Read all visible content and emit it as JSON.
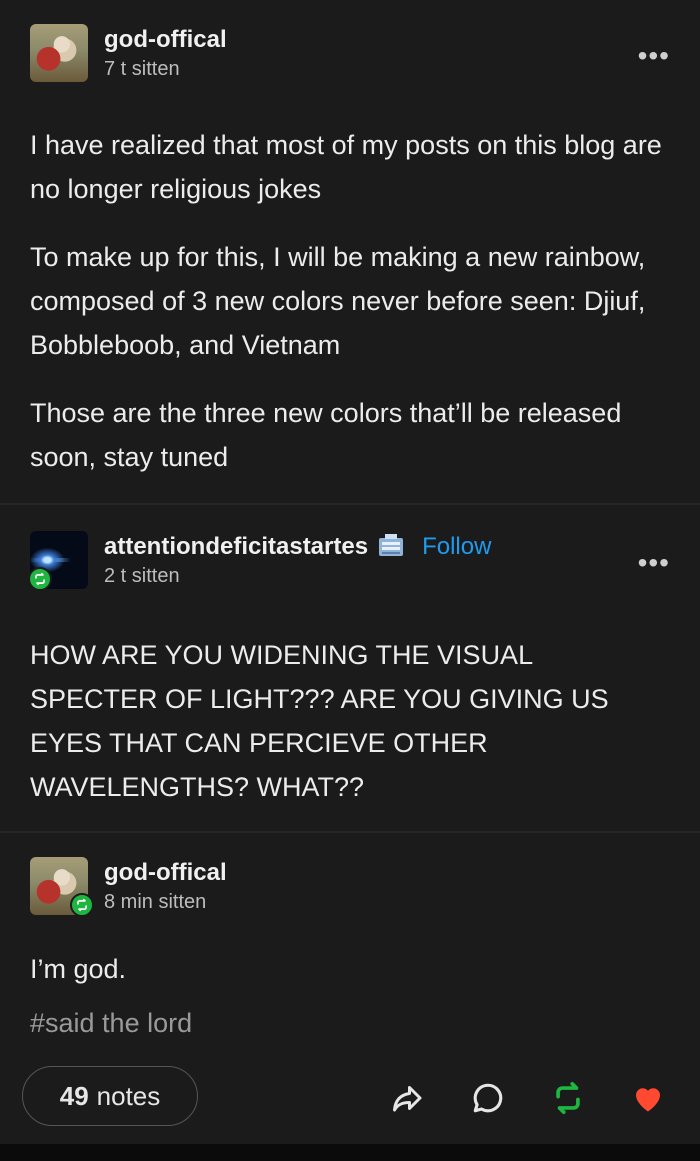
{
  "posts": [
    {
      "username": "god-offical",
      "time": "7 t sitten",
      "avatar": "god-painting-avatar",
      "paragraphs": [
        "I have realized that most of my posts on this blog are no longer religious jokes",
        "To make up for this, I will be making a new rainbow, composed of 3 new colors never before seen: Djiuf, Bobbleboob, and Vietnam",
        "Those are the three new colors that’ll be released soon, stay tuned"
      ]
    },
    {
      "username": "attentiondeficitastartes",
      "follow_label": "Follow",
      "time": "2 t sitten",
      "avatar": "space-light-avatar",
      "text": "HOW ARE YOU WIDENING THE VISUAL SPECTER OF LIGHT??? ARE YOU GIVING US EYES THAT CAN PERCIEVE OTHER WAVELENGTHS? WHAT??"
    },
    {
      "username": "god-offical",
      "time": "8 min sitten",
      "avatar": "god-painting-avatar",
      "text": "I’m god.",
      "tag": "#said the lord"
    }
  ],
  "more_label": "•••",
  "footer": {
    "notes_count": "49",
    "notes_label": "notes"
  },
  "colors": {
    "background": "#1b1b1b",
    "follow": "#1e9bf0",
    "reblog": "#1fb541",
    "like": "#ff4930"
  }
}
